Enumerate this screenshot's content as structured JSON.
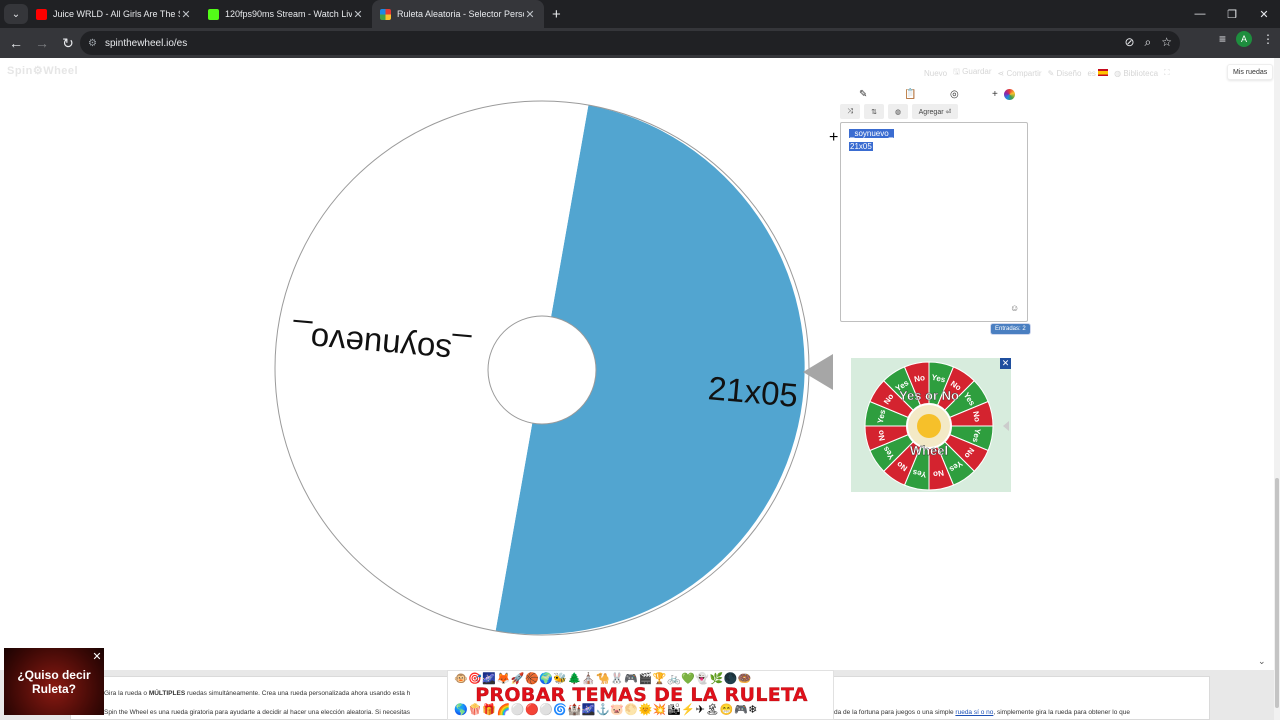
{
  "browser": {
    "tabs": [
      {
        "title": "Juice WRLD - All Girls Are The Sa",
        "favicon_color": "#ff0000",
        "active": false
      },
      {
        "title": "120fps90ms Stream - Watch Live",
        "favicon_color": "#53fc18",
        "active": false
      },
      {
        "title": "Ruleta Aleatoria - Selector Perso",
        "favicon_color": "#1e88e5",
        "active": true
      }
    ],
    "url": "spinthewheel.io/es",
    "profile_initial": "A"
  },
  "site": {
    "logo": "Spin⚙Wheel",
    "menu": [
      "Nuevo",
      "Guardar",
      "Compartir",
      "Diseño",
      "es",
      "Biblioteca"
    ],
    "mis_ruedas": "Mis ruedas"
  },
  "wheel": {
    "segments": [
      {
        "label": "_soynuevo_",
        "color": "#ffffff"
      },
      {
        "label": "21x05",
        "color": "#52a5d0"
      }
    ],
    "rotation_deg": 190
  },
  "editor": {
    "add_button": "Agregar ⏎",
    "entries": [
      "_soynuevo_",
      "21x05"
    ],
    "count_label": "Entradas: 2"
  },
  "ads": {
    "yes_no": {
      "title": "Yes or No",
      "subtitle": "Wheel",
      "words": [
        "Yes",
        "No"
      ]
    },
    "quiso": {
      "line1": "¿Quiso decir",
      "line2": "Ruleta?"
    },
    "probar": {
      "text": "PROBAR TEMAS DE LA RULETA",
      "emoji_top": "🐵🎯🌌🦊🚀🏀🌍🐝🌲⛪🐪🐰🎮🎬🏆🚲💚👻🌿🌑🍩",
      "emoji_bottom": "🌎🍿🎁🌈⚪🔴⚪🌀🏰🌌⚓🐷🌕🌞💥🏙⚡✈🏝😁🎮❄"
    }
  },
  "footer": {
    "line1_pre": "Gira la rueda o ",
    "line1_bold": "MÚLTIPLES",
    "line1_post": " ruedas simultáneamente. Crea una rueda personalizada ahora usando esta h",
    "line2_pre": "Spin the Wheel es una rueda giratoria para ayudarte a decidir al hacer una elección aleatoria. Si necesitas",
    "line2_right_pre": "da de la fortuna para juegos o una simple ",
    "line2_link": "rueda sí o no",
    "line2_right_post": ", simplemente gira la rueda para obtener lo que"
  }
}
